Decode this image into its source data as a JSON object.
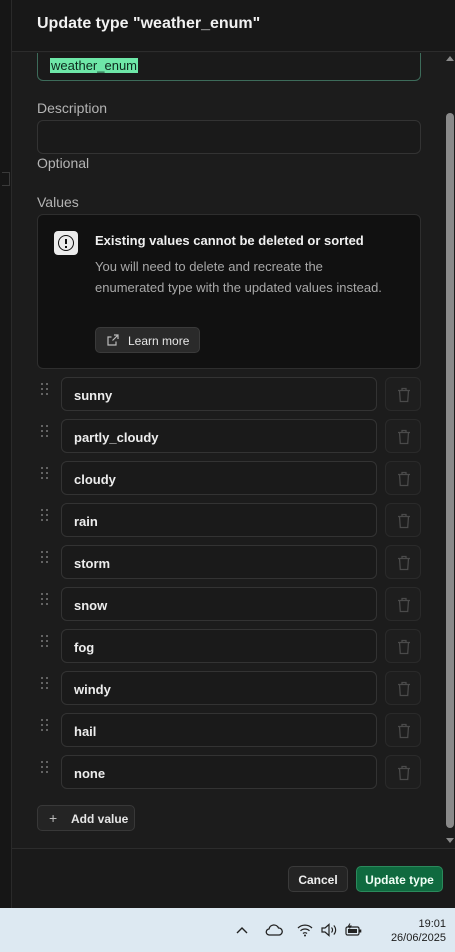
{
  "dialog": {
    "title": "Update type \"weather_enum\""
  },
  "form": {
    "name_value": "weather_enum",
    "description_label": "Description",
    "description_value": "",
    "description_hint": "Optional",
    "values_label": "Values"
  },
  "notice": {
    "title": "Existing values cannot be deleted or sorted",
    "body": "You will need to delete and recreate the enumerated type with the updated values instead.",
    "learn_more_label": "Learn more"
  },
  "values": [
    "sunny",
    "partly_cloudy",
    "cloudy",
    "rain",
    "storm",
    "snow",
    "fog",
    "windy",
    "hail",
    "none"
  ],
  "actions": {
    "add_value_label": "Add value",
    "cancel_label": "Cancel",
    "update_label": "Update type"
  },
  "taskbar": {
    "time": "19:01",
    "date": "26/06/2025"
  },
  "colors": {
    "primary_button": "#0f6a3f",
    "selection_highlight": "#6ee7a8"
  }
}
